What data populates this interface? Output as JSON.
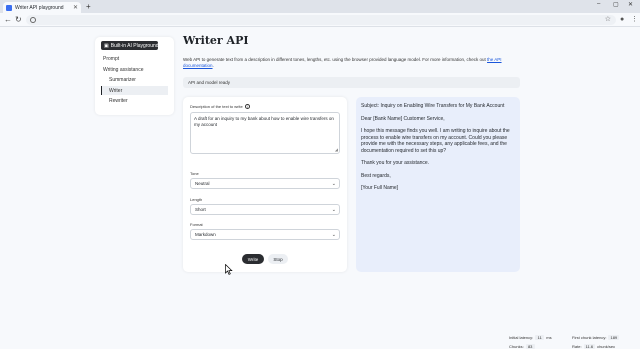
{
  "browser": {
    "tab_title": "Writer API playground",
    "new_tab_icon": "plus-icon",
    "window_controls": [
      "minimize-icon",
      "maximize-icon",
      "close-icon"
    ]
  },
  "sidebar": {
    "brand": "Built-in AI Playground",
    "items": [
      {
        "label": "Prompt",
        "level": 0,
        "active": false
      },
      {
        "label": "Writing assistance",
        "level": 0,
        "active": false
      },
      {
        "label": "Summarizer",
        "level": 1,
        "active": false
      },
      {
        "label": "Writer",
        "level": 1,
        "active": true
      },
      {
        "label": "Rewriter",
        "level": 1,
        "active": false
      }
    ]
  },
  "main": {
    "title": "Writer API",
    "description": "Web API to generate text from a description in different tones, lengths, etc. using the browser provided language model. For more information, check out",
    "link_text": "the API documentation",
    "description_end": ".",
    "status": "API and model ready"
  },
  "form": {
    "prompt_label": "Description of the text to write",
    "prompt_value": "A draft for an inquiry to my bank about how to enable wire transfers on my account",
    "tone_label": "Tone",
    "tone_value": "Neutral",
    "length_label": "Length",
    "length_value": "Short",
    "format_label": "Format",
    "format_value": "Markdown",
    "write_label": "Write",
    "stop_label": "Stop"
  },
  "output": {
    "paragraphs": [
      "Subject: Inquiry on Enabling Wire Transfers for My Bank Account",
      "Dear [Bank Name] Customer Service,",
      "I hope this message finds you well. I am writing to inquire about the process to enable wire transfers on my account. Could you please provide me with the necessary steps, any applicable fees, and the documentation required to set this up?",
      "Thank you for your assistance.",
      "Best regards,",
      "[Your Full Name]"
    ]
  },
  "metrics": {
    "initial_latency_label": "Initial latency:",
    "initial_latency_value": "11",
    "initial_latency_unit": "ms",
    "chunks_label": "Chunks:",
    "chunks_value": "83",
    "first_chunk_label": "First chunk latency:",
    "first_chunk_value": "189",
    "rate_label": "Rate:",
    "rate_value": "11.6",
    "rate_unit": "chunk/sec"
  }
}
